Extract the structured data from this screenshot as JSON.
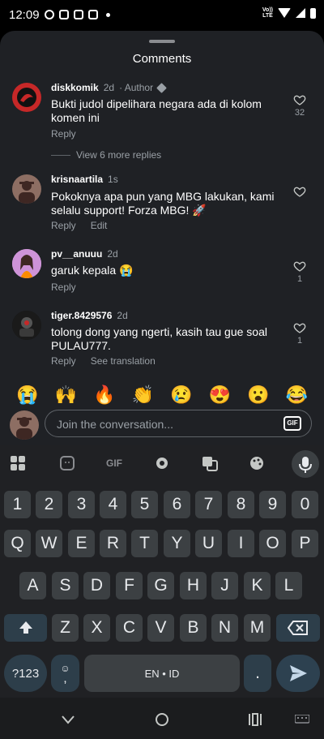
{
  "status_bar": {
    "time": "12:09",
    "volte_top": "Vo))",
    "volte_bottom": "LTE"
  },
  "sheet": {
    "title": "Comments"
  },
  "comments": [
    {
      "username": "diskkomik",
      "time": "2d",
      "badge": "· Author",
      "text": "Bukti judol dipelihara negara ada di kolom komen ini",
      "reply": "Reply",
      "likes": "32",
      "view_more": "View 6 more replies"
    },
    {
      "username": "krisnaartila",
      "time": "1s",
      "text": "Pokoknya apa pun yang MBG lakukan, kami selalu support! Forza MBG! 🚀",
      "reply": "Reply",
      "secondary": "Edit"
    },
    {
      "username": "pv__anuuu",
      "time": "2d",
      "text": "garuk kepala 😭",
      "reply": "Reply",
      "likes": "1"
    },
    {
      "username": "tiger.8429576",
      "time": "2d",
      "text": "tolong dong yang ngerti, kasih tau gue soal PULAU777.",
      "reply": "Reply",
      "secondary": "See translation",
      "likes": "1"
    }
  ],
  "emoji_bar": [
    "😭",
    "🙌",
    "🔥",
    "👏",
    "😢",
    "😍",
    "😮",
    "😂"
  ],
  "compose": {
    "placeholder": "Join the conversation...",
    "gif_label": "GIF"
  },
  "keyboard": {
    "toolbar": {
      "gif": "GIF"
    },
    "number_row": [
      "1",
      "2",
      "3",
      "4",
      "5",
      "6",
      "7",
      "8",
      "9",
      "0"
    ],
    "row1": [
      "Q",
      "W",
      "E",
      "R",
      "T",
      "Y",
      "U",
      "I",
      "O",
      "P"
    ],
    "row2": [
      "A",
      "S",
      "D",
      "F",
      "G",
      "H",
      "J",
      "K",
      "L"
    ],
    "row3": [
      "Z",
      "X",
      "C",
      "V",
      "B",
      "N",
      "M"
    ],
    "symbols_key": "?123",
    "space_label": "EN • ID",
    "period_key": ".",
    "comma_key": ","
  },
  "colors": {
    "sheet_bg": "#1f2125",
    "key_bg": "#3c4043",
    "accent_key": "#2d3e4a"
  }
}
